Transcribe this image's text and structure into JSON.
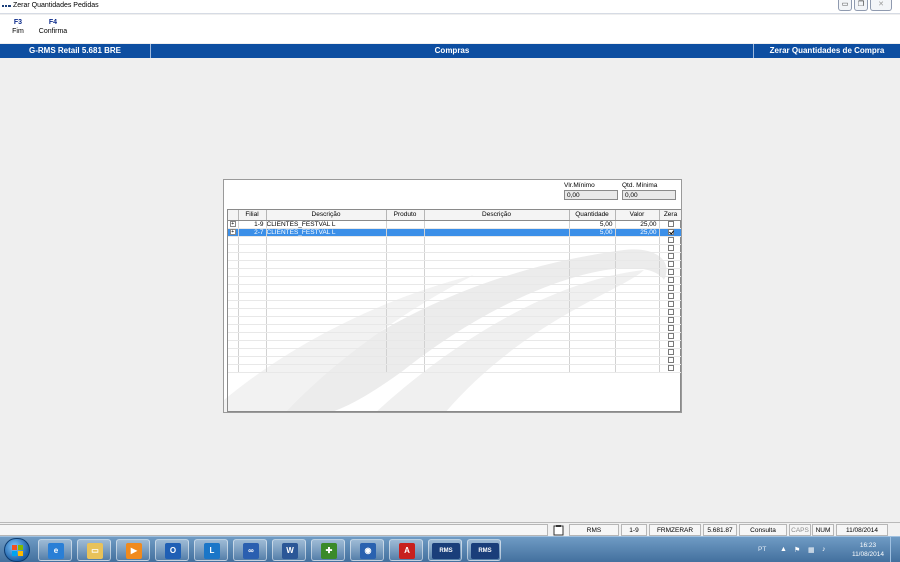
{
  "window": {
    "title": "Zerar Quantidades Pedidas",
    "buttons": {
      "minimize": "▭",
      "restore": "❐",
      "close": "✕"
    }
  },
  "fkeys": [
    {
      "key": "F3",
      "label": "Fim"
    },
    {
      "key": "F4",
      "label": "Confirma"
    }
  ],
  "header": {
    "left": "G-RMS Retail 5.681 BRE",
    "center": "Compras",
    "right": "Zerar Quantidades de Compra"
  },
  "filters": {
    "vl_minimo_label": "Vlr.Mínimo",
    "vl_minimo_value": "0,00",
    "qtd_minima_label": "Qtd. Mínima",
    "qtd_minima_value": "0,00"
  },
  "grid": {
    "columns": [
      "Filial",
      "Descrição",
      "Produto",
      "Descrição",
      "Quantidade",
      "Valor",
      "Zera"
    ],
    "rows": [
      {
        "filial": "1-9",
        "descricao": "CLIENTES_FESTVAL L",
        "produto": "",
        "descricao_prod": "",
        "quantidade": "5,00",
        "valor": "25,00",
        "zera": false,
        "selected": false
      },
      {
        "filial": "2-7",
        "descricao": "CLIENTES_FESTVAL L",
        "produto": "",
        "descricao_prod": "",
        "quantidade": "5,00",
        "valor": "25,00",
        "zera": true,
        "selected": true
      }
    ]
  },
  "status": {
    "app": "RMS",
    "filial": "1-9",
    "form": "FRMZERAR",
    "version": "5.681.87",
    "mode": "Consulta",
    "caps": "CAPS",
    "num": "NUM",
    "date": "11/08/2014"
  },
  "taskbar": {
    "apps": [
      {
        "name": "ie-icon",
        "glyph": "e",
        "color": "#2a7fd6"
      },
      {
        "name": "folder-icon",
        "glyph": "▭",
        "color": "#e8c25a"
      },
      {
        "name": "media-player-icon",
        "glyph": "▶",
        "color": "#f08a1e"
      },
      {
        "name": "outlook-icon",
        "glyph": "O",
        "color": "#1f5fb5"
      },
      {
        "name": "lync-icon",
        "glyph": "L",
        "color": "#1a76c8"
      },
      {
        "name": "infinity-icon",
        "glyph": "∞",
        "color": "#2a5fb0"
      },
      {
        "name": "word-icon",
        "glyph": "W",
        "color": "#2b5797"
      },
      {
        "name": "install-icon",
        "glyph": "✚",
        "color": "#3a8a2a"
      },
      {
        "name": "globe-icon",
        "glyph": "◉",
        "color": "#2a62b0"
      },
      {
        "name": "acrobat-icon",
        "glyph": "A",
        "color": "#c8201e"
      },
      {
        "name": "rms-icon-1",
        "glyph": "RMS",
        "color": "#1a3e7a"
      },
      {
        "name": "rms-icon-2",
        "glyph": "RMS",
        "color": "#1a3e7a"
      }
    ],
    "lang": "PT",
    "time": "16:23",
    "date": "11/08/2014"
  }
}
